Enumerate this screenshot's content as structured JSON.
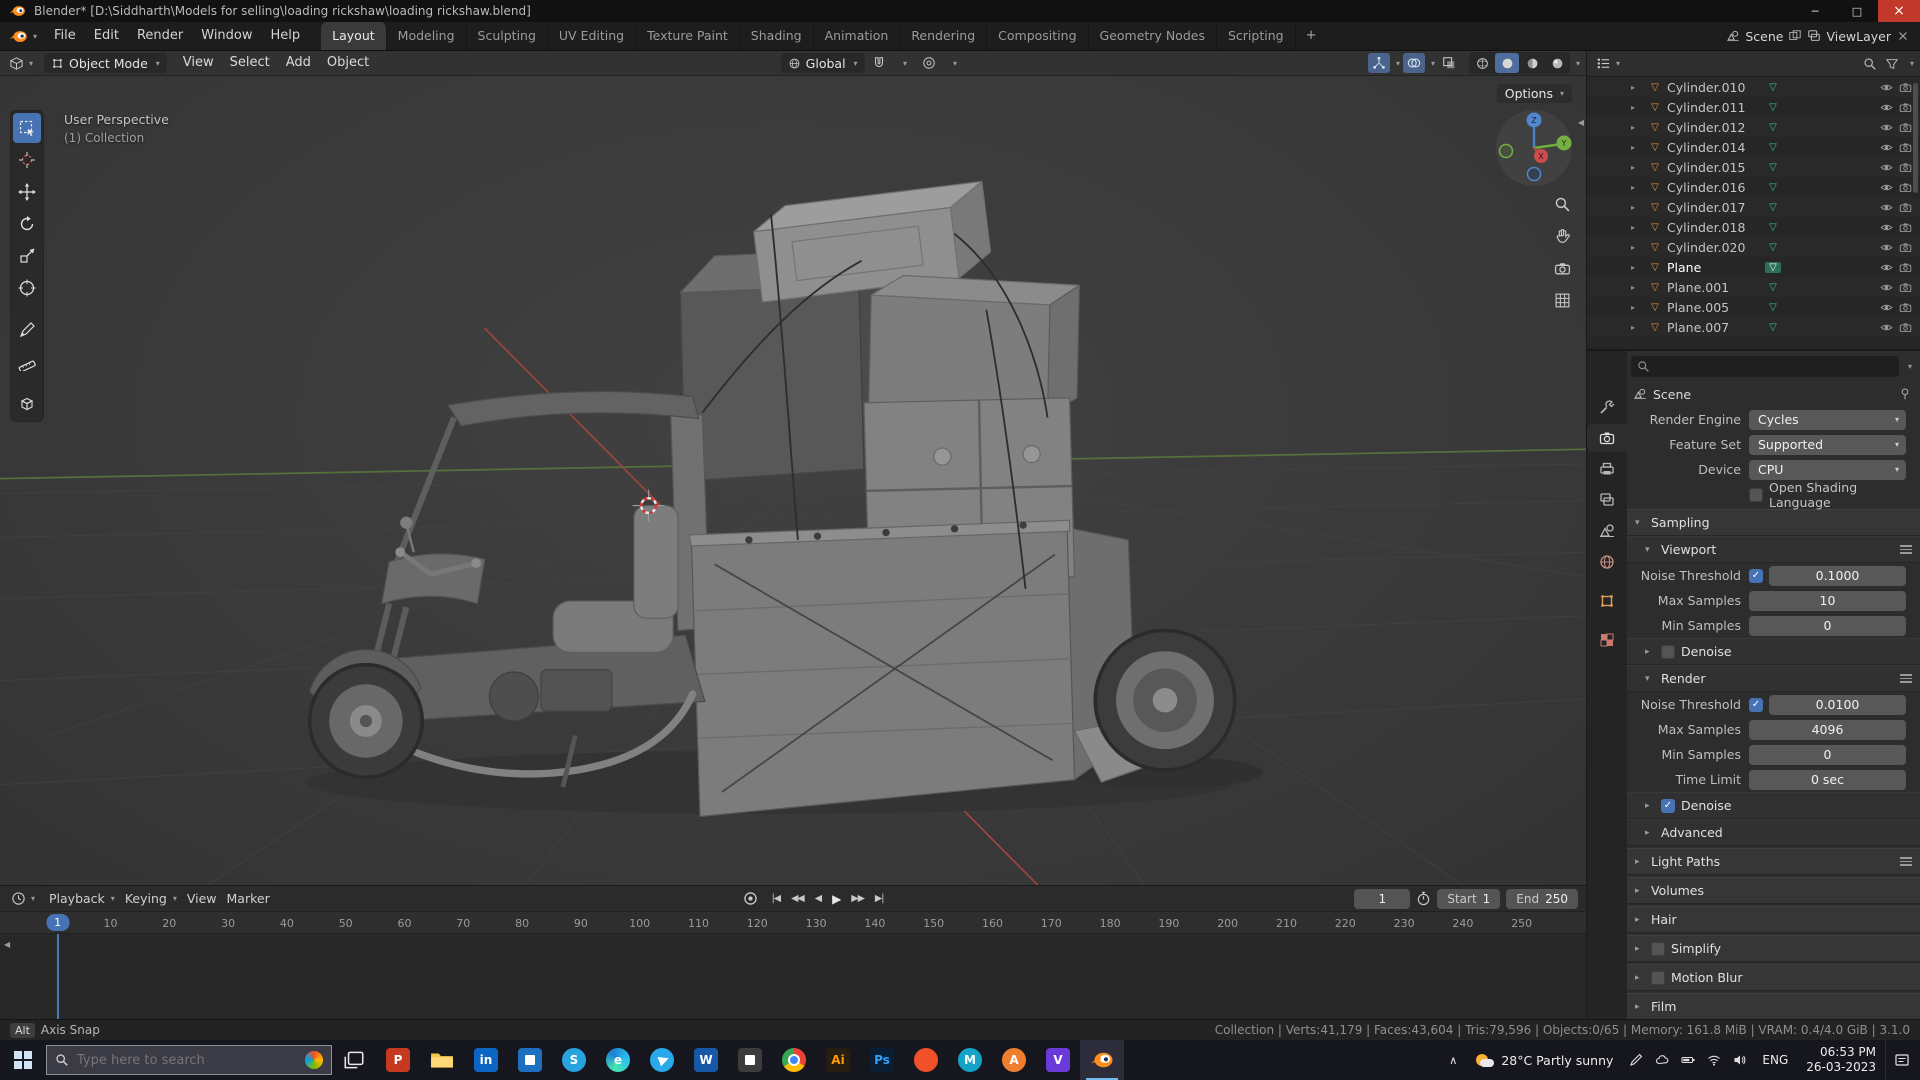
{
  "window": {
    "title": "Blender* [D:\\Siddharth\\Models for selling\\loading rickshaw\\loading rickshaw.blend]",
    "controls": {
      "minimize": "─",
      "maximize": "□",
      "close": "×"
    }
  },
  "menubar": {
    "menus": [
      "File",
      "Edit",
      "Render",
      "Window",
      "Help"
    ]
  },
  "workspaces": {
    "tabs": [
      "Layout",
      "Modeling",
      "Sculpting",
      "UV Editing",
      "Texture Paint",
      "Shading",
      "Animation",
      "Rendering",
      "Compositing",
      "Geometry Nodes",
      "Scripting"
    ],
    "active": "Layout",
    "add_label": "+"
  },
  "scene_selector": {
    "scene": "Scene",
    "viewlayer": "ViewLayer"
  },
  "viewport": {
    "mode": "Object Mode",
    "menus": [
      "View",
      "Select",
      "Add",
      "Object"
    ],
    "orientation": "Global",
    "options_label": "Options",
    "perspective_label": "User Perspective",
    "collection_label": "(1) Collection",
    "gizmo": {
      "x": "X",
      "y": "Y",
      "z": "Z"
    },
    "tools": [
      {
        "name": "select-box",
        "active": true
      },
      {
        "name": "cursor"
      },
      {
        "name": "move"
      },
      {
        "name": "rotate"
      },
      {
        "name": "scale"
      },
      {
        "name": "transform"
      },
      {
        "name": "annotate",
        "group": true
      },
      {
        "name": "measure"
      },
      {
        "name": "add-cube",
        "group": true
      }
    ]
  },
  "outliner": {
    "items": [
      {
        "name": "Cylinder.010"
      },
      {
        "name": "Cylinder.011"
      },
      {
        "name": "Cylinder.012"
      },
      {
        "name": "Cylinder.014"
      },
      {
        "name": "Cylinder.015"
      },
      {
        "name": "Cylinder.016"
      },
      {
        "name": "Cylinder.017"
      },
      {
        "name": "Cylinder.018"
      },
      {
        "name": "Cylinder.020"
      },
      {
        "name": "Plane",
        "selected": true
      },
      {
        "name": "Plane.001"
      },
      {
        "name": "Plane.005"
      },
      {
        "name": "Plane.007"
      }
    ]
  },
  "properties": {
    "tabs": [
      {
        "name": "tool"
      },
      {
        "name": "render",
        "active": true
      },
      {
        "name": "output"
      },
      {
        "name": "view-layer"
      },
      {
        "name": "scene"
      },
      {
        "name": "world"
      },
      {
        "name": "object"
      },
      {
        "name": "texture"
      }
    ],
    "breadcrumb": "Scene",
    "engine_rows": [
      {
        "label": "Render Engine",
        "value": "Cycles"
      },
      {
        "label": "Feature Set",
        "value": "Supported"
      },
      {
        "label": "Device",
        "value": "CPU"
      }
    ],
    "osl": {
      "label": "Open Shading Language",
      "checked": false
    },
    "panels": [
      {
        "type": "header",
        "label": "Sampling",
        "open": true
      },
      {
        "type": "subheader",
        "label": "Viewport",
        "open": true,
        "menu": true
      },
      {
        "type": "row",
        "label": "Noise Threshold",
        "value": "0.1000",
        "checkbox": true,
        "checked": true
      },
      {
        "type": "row",
        "label": "Max Samples",
        "value": "10"
      },
      {
        "type": "row",
        "label": "Min Samples",
        "value": "0"
      },
      {
        "type": "subheader",
        "label": "Denoise",
        "open": false,
        "checkbox": true,
        "checked": false
      },
      {
        "type": "subheader",
        "label": "Render",
        "open": true,
        "menu": true
      },
      {
        "type": "row",
        "label": "Noise Threshold",
        "value": "0.0100",
        "checkbox": true,
        "checked": true
      },
      {
        "type": "row",
        "label": "Max Samples",
        "value": "4096"
      },
      {
        "type": "row",
        "label": "Min Samples",
        "value": "0"
      },
      {
        "type": "row",
        "label": "Time Limit",
        "value": "0 sec"
      },
      {
        "type": "subheader",
        "label": "Denoise",
        "open": false,
        "checkbox": true,
        "checked": true
      },
      {
        "type": "subheader",
        "label": "Advanced",
        "open": false
      },
      {
        "type": "header",
        "label": "Light Paths",
        "open": false,
        "menu": true
      },
      {
        "type": "header",
        "label": "Volumes",
        "open": false
      },
      {
        "type": "header",
        "label": "Hair",
        "open": false
      },
      {
        "type": "header",
        "label": "Simplify",
        "open": false,
        "checkbox": true,
        "checked": false
      },
      {
        "type": "header",
        "label": "Motion Blur",
        "open": false,
        "checkbox": true,
        "checked": false
      },
      {
        "type": "header",
        "label": "Film",
        "open": false
      }
    ]
  },
  "timeline": {
    "menus": [
      {
        "label": "Playback",
        "dropdown": true
      },
      {
        "label": "Keying",
        "dropdown": true
      },
      {
        "label": "View"
      },
      {
        "label": "Marker"
      }
    ],
    "transport": [
      "jump-start",
      "prev-keyframe",
      "play-reverse",
      "play",
      "next-keyframe",
      "jump-end"
    ],
    "current_frame": "1",
    "start_label": "Start",
    "start_value": "1",
    "end_label": "End",
    "end_value": "250",
    "ticks": [
      10,
      20,
      30,
      40,
      50,
      60,
      70,
      80,
      90,
      100,
      110,
      120,
      130,
      140,
      150,
      160,
      170,
      180,
      190,
      200,
      210,
      220,
      230,
      240,
      250
    ]
  },
  "statusbar": {
    "key_hint": "Alt",
    "action_hint": "Axis Snap",
    "stats": "Collection | Verts:41,179 | Faces:43,604 | Tris:79,596 | Objects:0/65 | Memory: 161.8 MiB | VRAM: 0.4/4.0 GiB | 3.1.0"
  },
  "taskbar": {
    "search_placeholder": "Type here to search",
    "apps": [
      {
        "name": "task-view",
        "kind": "taskview"
      },
      {
        "name": "powerpoint",
        "kind": "tile",
        "label": "P",
        "bg": "#c5391f",
        "fg": "#ffffff"
      },
      {
        "name": "file-explorer",
        "kind": "folder"
      },
      {
        "name": "linkedin",
        "kind": "tile",
        "label": "in",
        "bg": "#0a66c2",
        "fg": "#ffffff"
      },
      {
        "name": "mail-app",
        "kind": "tile",
        "label": "",
        "bg": "#1f6fc0",
        "fg": "#ffffff"
      },
      {
        "name": "skype",
        "kind": "round",
        "label": "S",
        "bg": "#27a3e0",
        "fg": "#ffffff"
      },
      {
        "name": "edge",
        "kind": "edge",
        "label": "e"
      },
      {
        "name": "telegram",
        "kind": "telegram"
      },
      {
        "name": "word",
        "kind": "tile",
        "label": "W",
        "bg": "#1759a8",
        "fg": "#ffffff"
      },
      {
        "name": "code-app",
        "kind": "tile",
        "label": "",
        "bg": "#3c3c3c",
        "fg": "#ffffff"
      },
      {
        "name": "chrome",
        "kind": "chrome"
      },
      {
        "name": "illustrator",
        "kind": "tile",
        "label": "Ai",
        "bg": "#271d10",
        "fg": "#ff9a00"
      },
      {
        "name": "photoshop",
        "kind": "tile",
        "label": "Ps",
        "bg": "#0a1f33",
        "fg": "#2fa3f7"
      },
      {
        "name": "orange-app",
        "kind": "round",
        "label": "",
        "bg": "#f0502a",
        "fg": "#ffffff"
      },
      {
        "name": "teal-app",
        "kind": "round",
        "label": "M",
        "bg": "#14a3c7",
        "fg": "#ffffff"
      },
      {
        "name": "autodesk-app",
        "kind": "round",
        "label": "A",
        "bg": "#ef7f2e",
        "fg": "#ffffff"
      },
      {
        "name": "purple-app",
        "kind": "tile",
        "label": "V",
        "bg": "#6a3bd8",
        "fg": "#ffffff"
      },
      {
        "name": "blender",
        "kind": "blender",
        "active": true
      }
    ],
    "tray_icons": [
      "pen-icon",
      "cloud-icon",
      "battery-icon",
      "wifi-icon",
      "volume-icon"
    ],
    "weather": "28°C Partly sunny",
    "language": "ENG",
    "time": "06:53 PM",
    "date": "26-03-2023"
  },
  "colors": {
    "accent": "#4772b3",
    "blender_orange": "#ea7600",
    "mesh_icon": "#e0933c",
    "data_icon": "#3fbf8f"
  }
}
